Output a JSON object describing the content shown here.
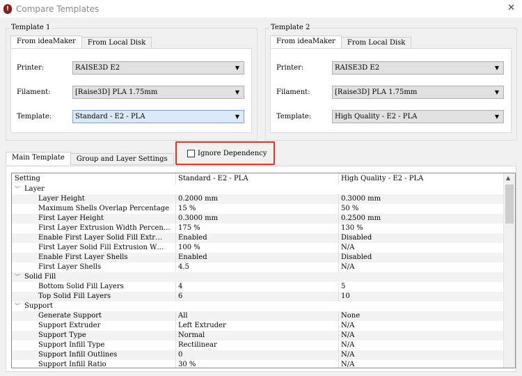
{
  "window": {
    "title": "Compare Templates"
  },
  "template1": {
    "label": "Template 1",
    "tabs": [
      "From ideaMaker",
      "From Local Disk"
    ],
    "printer_label": "Printer:",
    "printer": "RAISE3D E2",
    "filament_label": "Filament:",
    "filament": "[Raise3D] PLA 1.75mm",
    "template_label": "Template:",
    "template": "Standard - E2 - PLA"
  },
  "template2": {
    "label": "Template 2",
    "tabs": [
      "From ideaMaker",
      "From Local Disk"
    ],
    "printer_label": "Printer:",
    "printer": "RAISE3D E2",
    "filament_label": "Filament:",
    "filament": "[Raise3D] PLA 1.75mm",
    "template_label": "Template:",
    "template": "High Quality - E2 - PLA"
  },
  "bottom_tabs": [
    "Main Template",
    "Group and Layer Settings"
  ],
  "ignore_dependency": {
    "label": "Ignore Dependency",
    "checked": false
  },
  "table": {
    "headers": [
      "Setting",
      "Standard - E2 - PLA",
      "High Quality - E2 - PLA"
    ],
    "rows": [
      {
        "section": "Layer"
      },
      {
        "name": "Layer Height",
        "a": "0.2000 mm",
        "b": "0.3000 mm"
      },
      {
        "name": "Maximum Shells Overlap Percentage",
        "a": "15 %",
        "b": "50 %"
      },
      {
        "name": "First Layer Height",
        "a": "0.3000 mm",
        "b": "0.2500 mm"
      },
      {
        "name": "First Layer Extrusion Width Percen…",
        "a": "175 %",
        "b": "130 %"
      },
      {
        "name": "Enable First Layer Solid Fill Extr…",
        "a": "Enabled",
        "b": "Disabled"
      },
      {
        "name": "First Layer Solid Fill Extrusion W…",
        "a": "100 %",
        "b": "N/A"
      },
      {
        "name": "Enable First Layer Shells",
        "a": "Enabled",
        "b": "Disabled"
      },
      {
        "name": "First Layer Shells",
        "a": "4.5",
        "b": "N/A"
      },
      {
        "section": "Solid Fill"
      },
      {
        "name": "Bottom Solid Fill Layers",
        "a": "4",
        "b": "5"
      },
      {
        "name": "Top Solid Fill Layers",
        "a": "6",
        "b": "10"
      },
      {
        "section": "Support"
      },
      {
        "name": "Generate Support",
        "a": "All",
        "b": "None"
      },
      {
        "name": "Support Extruder",
        "a": "Left Extruder",
        "b": "N/A"
      },
      {
        "name": "Support Type",
        "a": "Normal",
        "b": "N/A"
      },
      {
        "name": "Support Infill Type",
        "a": "Rectilinear",
        "b": "N/A"
      },
      {
        "name": "Support Infill Outlines",
        "a": "0",
        "b": "N/A"
      },
      {
        "name": "Support Infill Ratio",
        "a": "30 %",
        "b": "N/A"
      }
    ]
  }
}
